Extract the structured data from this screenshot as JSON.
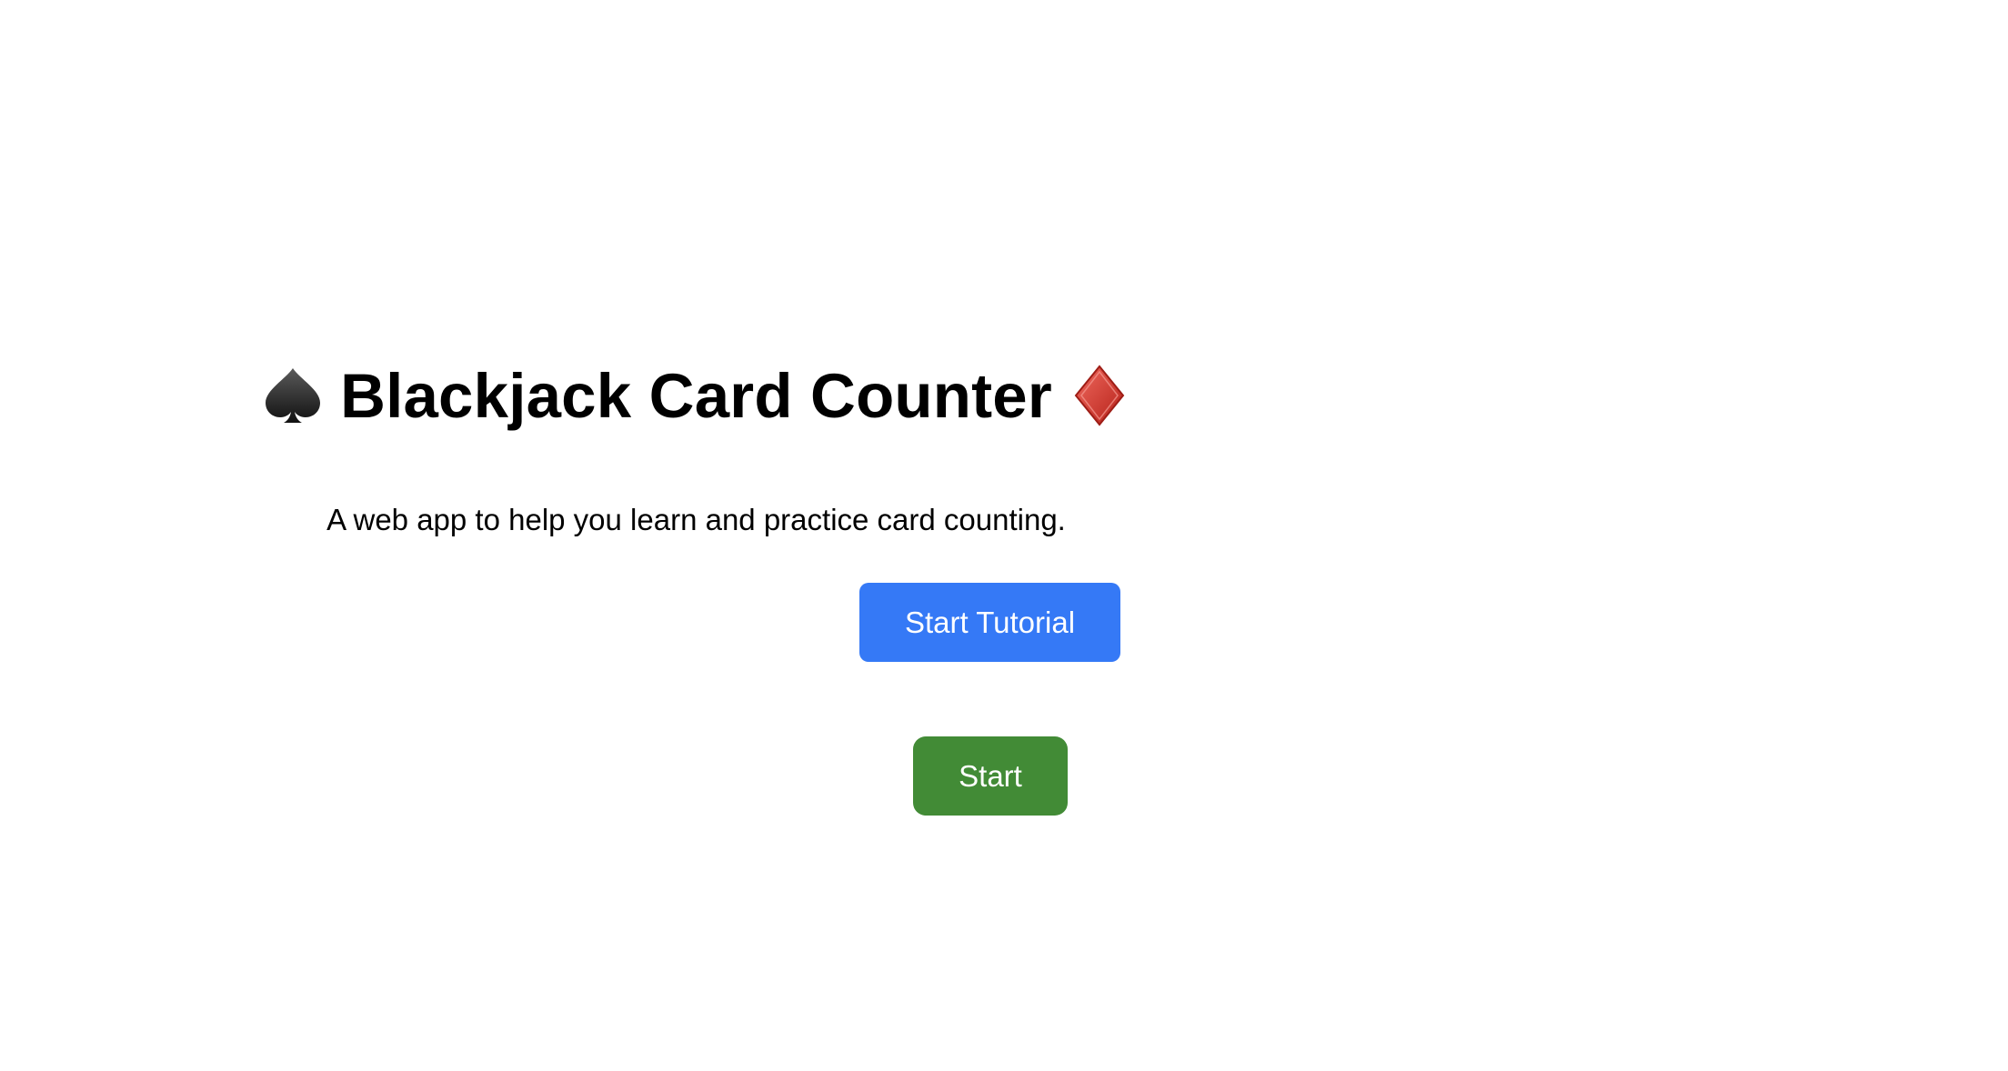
{
  "header": {
    "title": "Blackjack Card Counter",
    "left_icon": "spade-icon",
    "right_icon": "diamond-icon",
    "diamond_color": "#d93a33"
  },
  "main": {
    "subtitle": "A web app to help you learn and practice card counting.",
    "tutorial_button_label": "Start Tutorial",
    "start_button_label": "Start"
  },
  "colors": {
    "tutorial_button": "#3579f6",
    "start_button": "#428b36"
  }
}
